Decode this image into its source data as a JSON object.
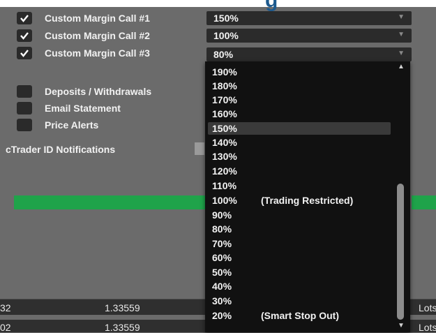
{
  "header": {
    "partial_text": "g"
  },
  "margin_calls": [
    {
      "label": "Custom Margin Call #1",
      "checked": true,
      "value": "150%"
    },
    {
      "label": "Custom Margin Call #2",
      "checked": true,
      "value": "100%"
    },
    {
      "label": "Custom Margin Call #3",
      "checked": true,
      "value": "80%"
    }
  ],
  "notifications": [
    {
      "label": "Deposits / Withdrawals",
      "checked": false
    },
    {
      "label": "Email Statement",
      "checked": false
    },
    {
      "label": "Price Alerts",
      "checked": false
    }
  ],
  "ctrader_id_label": "cTrader ID Notifications",
  "dropdown": {
    "selected": "150%",
    "options": [
      {
        "value": "190%",
        "note": ""
      },
      {
        "value": "180%",
        "note": ""
      },
      {
        "value": "170%",
        "note": ""
      },
      {
        "value": "160%",
        "note": ""
      },
      {
        "value": "150%",
        "note": ""
      },
      {
        "value": "140%",
        "note": ""
      },
      {
        "value": "130%",
        "note": ""
      },
      {
        "value": "120%",
        "note": ""
      },
      {
        "value": "110%",
        "note": ""
      },
      {
        "value": "100%",
        "note": "(Trading Restricted)"
      },
      {
        "value": "90%",
        "note": ""
      },
      {
        "value": "80%",
        "note": ""
      },
      {
        "value": "70%",
        "note": ""
      },
      {
        "value": "60%",
        "note": ""
      },
      {
        "value": "50%",
        "note": ""
      },
      {
        "value": "40%",
        "note": ""
      },
      {
        "value": "30%",
        "note": ""
      },
      {
        "value": "20%",
        "note": "(Smart Stop Out)"
      }
    ]
  },
  "table": {
    "rows": [
      {
        "id_tail": "32",
        "price": "1.33559",
        "unit": "Lots"
      },
      {
        "id_tail": "02",
        "price": "1.33559",
        "unit": "Lots"
      }
    ]
  },
  "colors": {
    "background": "#6b6b6b",
    "dropdown_bg": "#111111",
    "accent_green": "#1fa34a",
    "header_text": "#1d5a8e"
  }
}
